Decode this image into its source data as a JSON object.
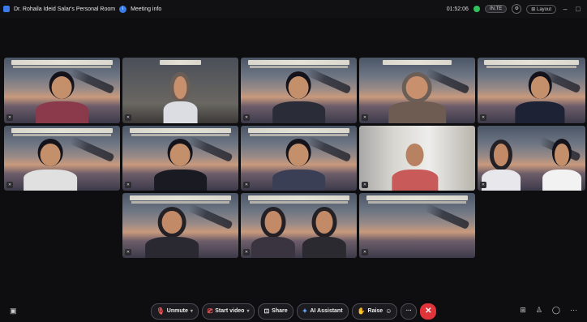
{
  "topbar": {
    "room_title": "Dr. Rohaila Ideid Salar's Personal Room",
    "meeting_info": "Meeting info",
    "timer": "01:52:06",
    "quality_label": "IN.TE",
    "layout_label": "Layout",
    "minimize": "–",
    "maximize": "□"
  },
  "toolbar": {
    "unmute": "Unmute",
    "start_video": "Start video",
    "share": "Share",
    "ai_assistant": "AI Assistant",
    "raise": "Raise",
    "more": "···",
    "end": "✕"
  },
  "icons": {
    "mute": "mic-off-icon",
    "video": "video-off-icon",
    "share": "share-icon",
    "ai": "ai-assistant-icon",
    "raise": "hand-icon",
    "reactions": "emoji-icon",
    "chat": "chat-icon",
    "participants": "participants-icon",
    "apps": "apps-icon"
  }
}
